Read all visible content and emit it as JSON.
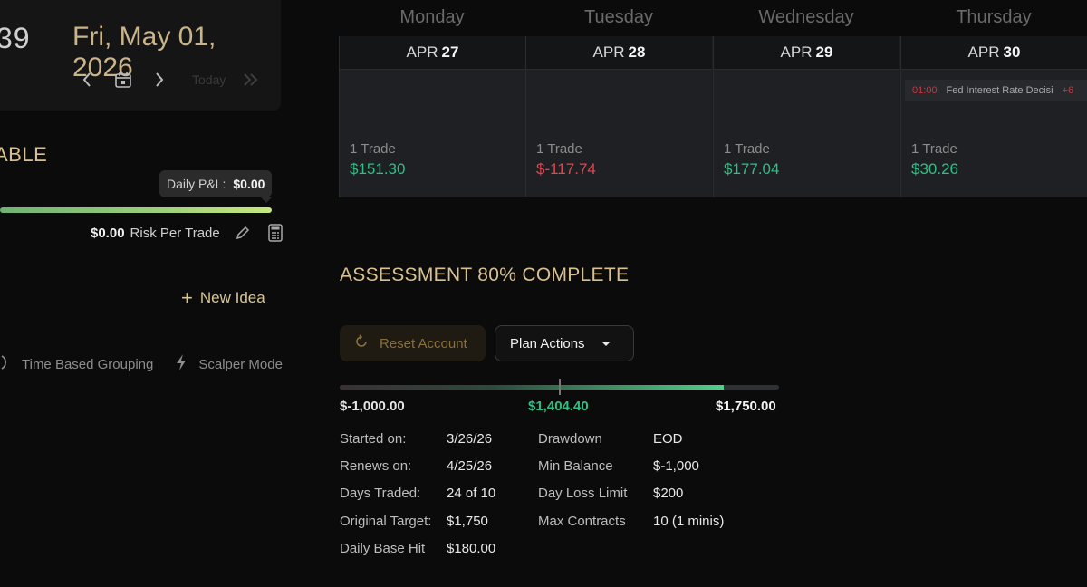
{
  "header": {
    "time_partial": "39",
    "date": "Fri, May 01, 2026",
    "today_label": "Today"
  },
  "account": {
    "status_partial": "ABLE",
    "daily_pnl_label": "Daily P&L:",
    "daily_pnl_value": "$0.00",
    "risk_value": "$0.00",
    "risk_label": "Risk Per Trade"
  },
  "actions": {
    "new_idea": "New Idea",
    "time_based_grouping": "Time Based Grouping",
    "scalper_mode": "Scalper Mode"
  },
  "calendar": {
    "weekdays": [
      "Monday",
      "Tuesday",
      "Wednesday",
      "Thursday"
    ],
    "days": [
      {
        "month": "APR",
        "day": "27",
        "trades": "1 Trade",
        "pnl": "$151.30",
        "pnl_sign": "positive"
      },
      {
        "month": "APR",
        "day": "28",
        "trades": "1 Trade",
        "pnl": "$-117.74",
        "pnl_sign": "negative"
      },
      {
        "month": "APR",
        "day": "29",
        "trades": "1 Trade",
        "pnl": "$177.04",
        "pnl_sign": "positive"
      },
      {
        "month": "APR",
        "day": "30",
        "trades": "1 Trade",
        "pnl": "$30.26",
        "pnl_sign": "positive"
      }
    ],
    "event": {
      "time": "01:00",
      "title": "Fed Interest Rate Decisi",
      "more": "+6"
    }
  },
  "assessment": {
    "title": "ASSESSMENT 80% COMPLETE",
    "reset_label": "Reset Account",
    "plan_actions_label": "Plan Actions",
    "progress_min": "$-1,000.00",
    "progress_current": "$1,404.40",
    "progress_max": "$1,750.00",
    "progress_fraction": 0.8733,
    "details_left": [
      {
        "label": "Started on:",
        "value": "3/26/26"
      },
      {
        "label": "Renews on:",
        "value": "4/25/26"
      },
      {
        "label": "Days Traded:",
        "value": "24 of 10"
      },
      {
        "label": "Original Target:",
        "value": "$1,750"
      },
      {
        "label": "Daily Base Hit",
        "value": "$180.00"
      }
    ],
    "details_right": [
      {
        "label": "Drawdown",
        "value": "EOD"
      },
      {
        "label": "Min Balance",
        "value": "$-1,000"
      },
      {
        "label": "Day Loss Limit",
        "value": "$200"
      },
      {
        "label": "Max Contracts",
        "value": "10 (1 minis)"
      }
    ]
  },
  "colors": {
    "gold": "#d9c18f",
    "positive": "#2fbf84",
    "negative": "#e1464f",
    "background": "#0b0b0b"
  },
  "icons": [
    "chevron-left-icon",
    "calendar-icon",
    "chevron-right-icon",
    "double-chevron-right-icon",
    "pencil-icon",
    "calculator-icon",
    "plus-icon",
    "clock-icon",
    "lightning-icon",
    "reset-icon",
    "caret-down-icon"
  ]
}
